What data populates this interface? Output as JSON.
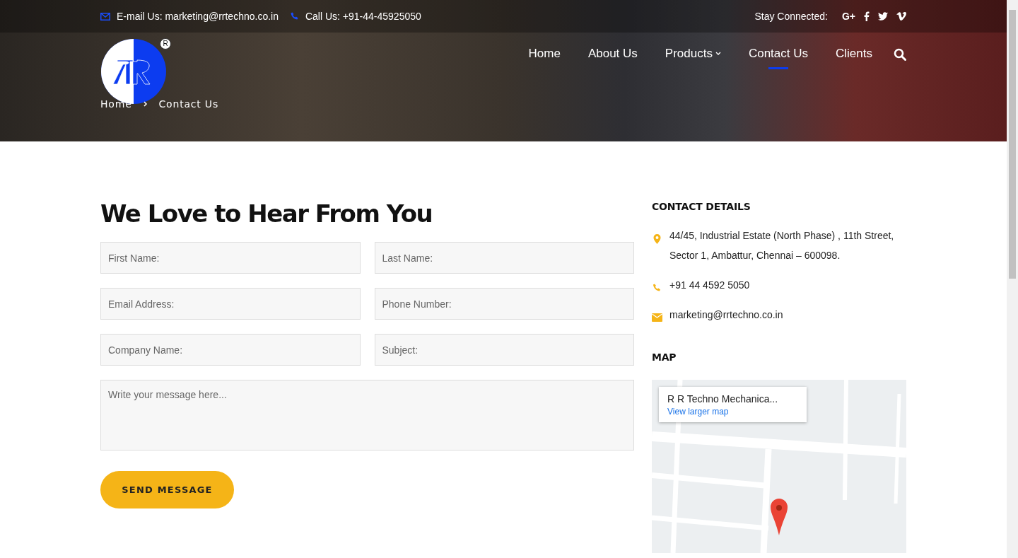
{
  "top_bar": {
    "email": "E-mail Us: marketing@rrtechno.co.in",
    "phone": "Call Us: +91-44-45925050",
    "social_label": "Stay Connected:",
    "social": [
      {
        "kind": "google-plus",
        "label": "G+"
      },
      {
        "kind": "facebook"
      },
      {
        "kind": "twitter"
      },
      {
        "kind": "vimeo"
      }
    ]
  },
  "nav": {
    "items": [
      {
        "label": "Home",
        "selected": false,
        "dropdown": false
      },
      {
        "label": "About Us",
        "selected": false,
        "dropdown": false
      },
      {
        "label": "Products",
        "selected": false,
        "dropdown": true
      },
      {
        "label": "Contact Us",
        "selected": true,
        "dropdown": false
      },
      {
        "label": "Clients",
        "selected": false,
        "dropdown": false
      }
    ]
  },
  "logo": {
    "registered_mark": "R"
  },
  "breadcrumb": [
    {
      "label": "Home"
    },
    {
      "label": "Contact Us"
    }
  ],
  "form": {
    "title": "We Love to Hear From You",
    "fields": [
      {
        "kind": "input",
        "placeholder": "First Name:"
      },
      {
        "kind": "input",
        "placeholder": "Last Name:"
      },
      {
        "kind": "input",
        "placeholder": "Email Address:"
      },
      {
        "kind": "input",
        "placeholder": "Phone Number:"
      },
      {
        "kind": "input",
        "placeholder": "Company Name:"
      },
      {
        "kind": "input",
        "placeholder": "Subject:"
      },
      {
        "kind": "textarea",
        "placeholder": "Write your message here..."
      }
    ],
    "submit": "SEND MESSAGE"
  },
  "contact_details": {
    "title": "CONTACT DETAILS",
    "items": [
      {
        "kind": "address",
        "text": "44/45, Industrial Estate (North Phase) , 11th Street, Sector 1, Ambattur, Chennai – 600098."
      },
      {
        "kind": "phone",
        "text": "+91 44 4592 5050"
      },
      {
        "kind": "email",
        "text": "marketing@rrtechno.co.in"
      }
    ]
  },
  "map": {
    "title": "MAP",
    "place_name": "R R Techno Mechanica...",
    "link": "View larger map"
  }
}
